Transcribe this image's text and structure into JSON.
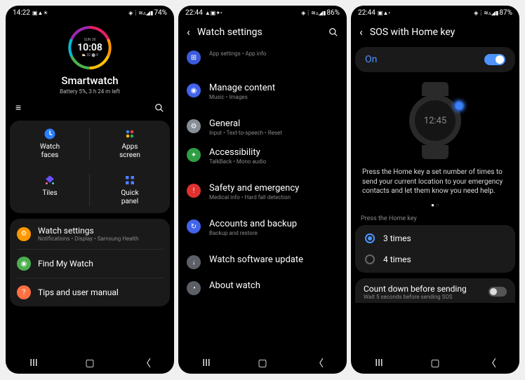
{
  "screen1": {
    "status": {
      "time": "14:22",
      "left_icons": "▣ ▲ ☀",
      "right_icons": "◈ ⋮ ≋ ▵ ◢ ▮",
      "battery": "74%"
    },
    "watch": {
      "day": "SUN 28",
      "time": "10:08",
      "sub": "⛅ 32  ⬤ 0"
    },
    "device_name": "Smartwatch",
    "battery_text": "Battery 5%, 3 h 24 m left",
    "grid": {
      "watch_faces": "Watch\nfaces",
      "apps_screen": "Apps\nscreen",
      "tiles": "Tiles",
      "quick_panel": "Quick\npanel"
    },
    "list": {
      "watch_settings": {
        "title": "Watch settings",
        "sub": "Notifications • Display • Samsung Health"
      },
      "find_my_watch": {
        "title": "Find My Watch"
      },
      "tips": {
        "title": "Tips and user manual"
      }
    }
  },
  "screen2": {
    "status": {
      "time": "22:44",
      "left_icons": "▲ ▣ ✦ •",
      "right_icons": "◈ ⋮ ≋ ▵ ◢ ▮",
      "battery": "86%"
    },
    "header": "Watch settings",
    "items": {
      "app_info": {
        "sub": "App settings • App info"
      },
      "manage_content": {
        "title": "Manage content",
        "sub": "Music • Images"
      },
      "general": {
        "title": "General",
        "sub": "Input • Text-to-speech • Reset"
      },
      "accessibility": {
        "title": "Accessibility",
        "sub": "TalkBack • Mono audio"
      },
      "safety": {
        "title": "Safety and emergency",
        "sub": "Medical info • Hard fall detection"
      },
      "accounts": {
        "title": "Accounts and backup",
        "sub": "Backup and restore"
      },
      "software": {
        "title": "Watch software update"
      },
      "about": {
        "title": "About watch"
      }
    }
  },
  "screen3": {
    "status": {
      "time": "22:44",
      "left_icons": "▣ ▲ •",
      "right_icons": "◈ ⋮ ≋ ▵ ◢ ▮",
      "battery": "87%"
    },
    "header": "SOS with Home key",
    "toggle_state": "On",
    "watch_time": "12:45",
    "description": "Press the Home key a set number of times to send your current location to your emergency contacts and let them know you need help.",
    "option_header": "Press the Home key",
    "options": {
      "three": "3 times",
      "four": "4 times"
    },
    "countdown": {
      "title": "Count down before sending",
      "sub": "Wait 5 seconds before sending SOS"
    }
  }
}
